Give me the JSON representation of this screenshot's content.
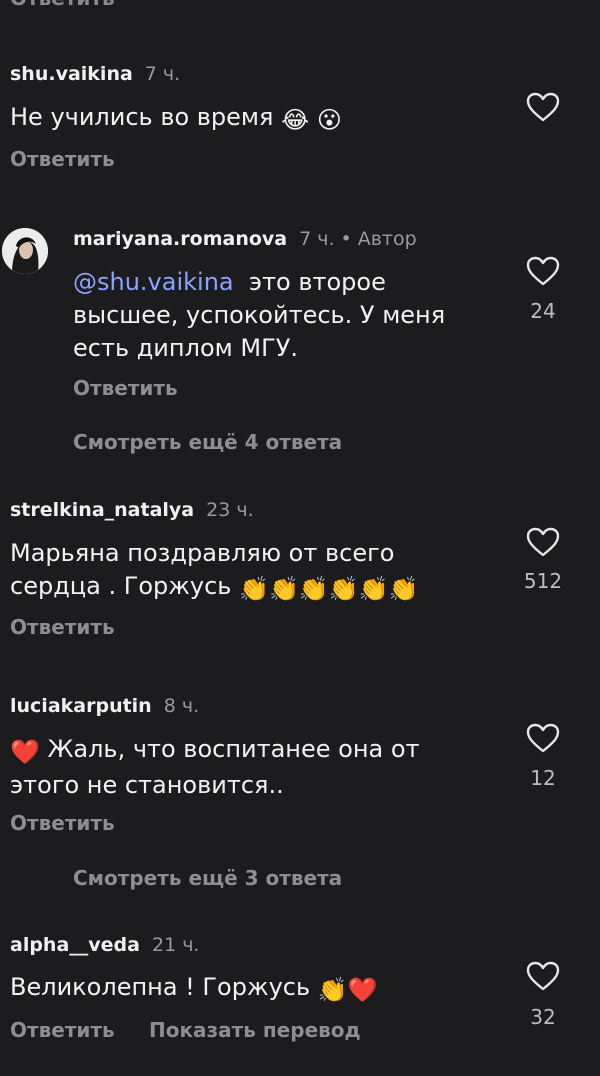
{
  "top_cut_label": "Ответить",
  "heart_icon": "heart-outline-icon",
  "comments": [
    {
      "username": "shu.vaikina",
      "time": "7 ч.",
      "text": "Не учились во время",
      "emojis": [
        "😂",
        "😮"
      ],
      "reply_label": "Ответить"
    },
    {
      "username": "mariyana.romanova",
      "time": "7 ч.",
      "separator": "•",
      "author_badge": "Автор",
      "mention": "@shu.vaikina",
      "text_line1": "это второе",
      "text_line2": "высшее, успокойтесь. У меня",
      "text_line3": "есть диплом МГУ.",
      "likes": "24",
      "reply_label": "Ответить"
    },
    {
      "view_more": "Смотреть ещё 4 ответа"
    },
    {
      "username": "strelkina_natalya",
      "time": "23 ч.",
      "text_line1": "Марьяна поздравляю от всего",
      "text_line2": "сердца . Горжусь",
      "emojis": [
        "👏",
        "👏",
        "👏",
        "👏",
        "👏",
        "👏"
      ],
      "likes": "512",
      "reply_label": "Ответить"
    },
    {
      "username": "luciakarputin",
      "time": "8 ч.",
      "emoji_lead": "❤️",
      "text_line1": "Жаль, что воспитанее она от",
      "text_line2": "этого не становится..",
      "likes": "12",
      "reply_label": "Ответить"
    },
    {
      "view_more": "Смотреть ещё 3 ответа"
    },
    {
      "username": "alpha__veda",
      "time": "21 ч.",
      "text": "Великолепна ! Горжусь",
      "emojis": [
        "👏",
        "❤️"
      ],
      "likes": "32",
      "reply_label": "Ответить",
      "translate_label": "Показать перевод"
    }
  ]
}
